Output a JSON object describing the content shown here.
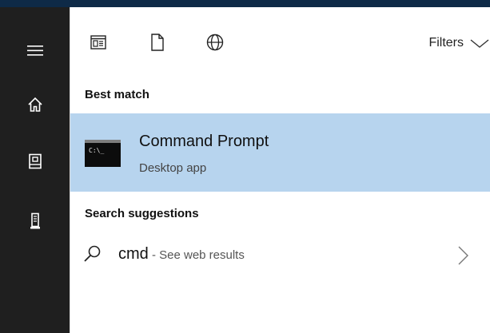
{
  "rail": {
    "items": [
      {
        "icon": "hamburger-menu-icon"
      },
      {
        "icon": "home-icon"
      },
      {
        "icon": "notebook-icon"
      },
      {
        "icon": "device-icon"
      }
    ]
  },
  "toolbar": {
    "filters_label": "Filters",
    "buttons": [
      "apps-icon",
      "documents-icon",
      "web-icon"
    ]
  },
  "results": {
    "best_match_title": "Best match",
    "best_match": {
      "icon_text": "C:\\_",
      "name": "Command Prompt",
      "type": "Desktop app"
    },
    "suggestions_title": "Search suggestions",
    "suggestion": {
      "query": "cmd",
      "suffix": " - See web results"
    }
  },
  "colors": {
    "rail": "#1f1f1f",
    "topbar": "#0e2a47",
    "selection": "#b7d4ee"
  }
}
